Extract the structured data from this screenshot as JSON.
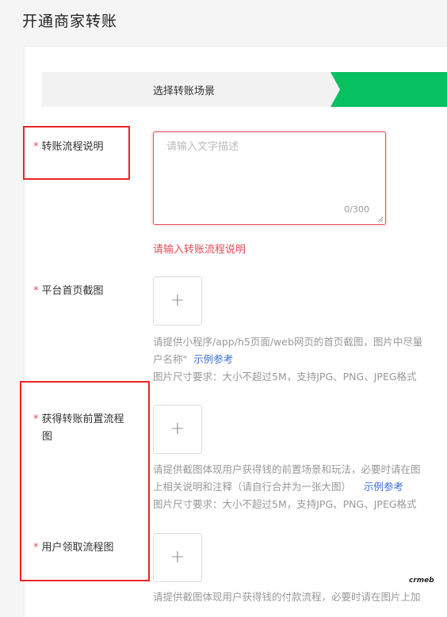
{
  "page_title": "开通商家转账",
  "steps": {
    "step1_label": "选择转账场景",
    "active_color": "#07c160"
  },
  "fields": {
    "process_desc": {
      "required_mark": "*",
      "label": "转账流程说明",
      "placeholder": "请输入文字描述",
      "counter": "0/300",
      "error": "请输入转账流程说明"
    },
    "homepage_screenshot": {
      "required_mark": "*",
      "label": "平台首页截图",
      "upload_icon": "plus-icon",
      "hint_line1": "请提供小程序/app/h5页面/web网页的首页截图，图片中尽量",
      "hint_line2": "户名称\"",
      "example_link": "示例参考",
      "size_hint": "图片尺寸要求：大小不超过5M，支持JPG、PNG、JPEG格式"
    },
    "pre_flow": {
      "required_mark": "*",
      "label_line1": "获得转账前置流程",
      "label_line2": "图",
      "upload_icon": "plus-icon",
      "hint_line1": "请提供截图体现用户获得钱的前置场景和玩法，必要时请在图",
      "hint_line2": "上相关说明和注释（请自行合并为一张大图）",
      "example_link": "示例参考",
      "size_hint": "图片尺寸要求：大小不超过5M，支持JPG、PNG、JPEG格式"
    },
    "claim_flow": {
      "required_mark": "*",
      "label": "用户领取流程图",
      "upload_icon": "plus-icon",
      "hint_line1": "请提供截图体现用户获得钱的付款流程，必要时请在图片上加"
    }
  },
  "watermark": "crmeb",
  "colors": {
    "error": "#e34d59",
    "link": "#3a6fd8",
    "annotation": "#ee2222"
  }
}
